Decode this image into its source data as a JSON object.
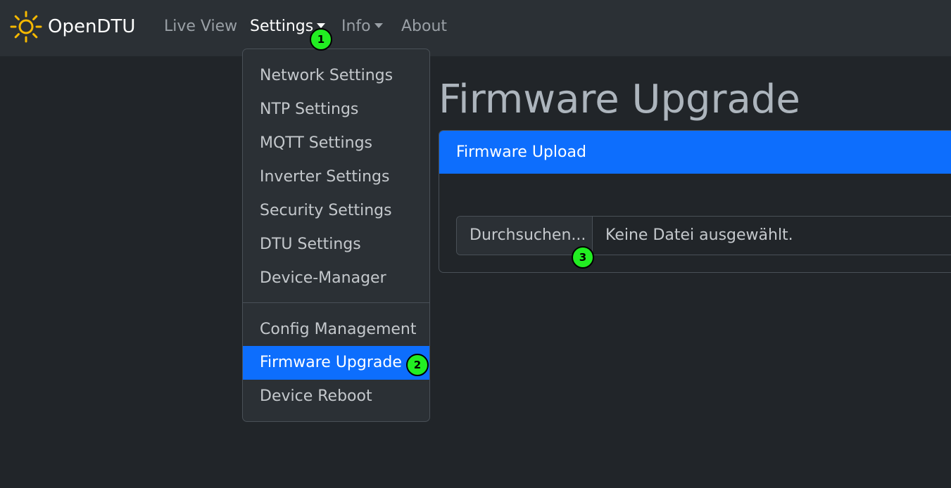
{
  "navbar": {
    "brand": {
      "icon": "sun-icon",
      "text": "OpenDTU",
      "icon_color": "#f5b800"
    },
    "links": [
      {
        "label": "Live View"
      },
      {
        "label": "Settings",
        "dropdown": true,
        "active": true
      },
      {
        "label": "Info",
        "dropdown": true
      },
      {
        "label": "About"
      }
    ]
  },
  "settings_menu": {
    "groups": [
      [
        "Network Settings",
        "NTP Settings",
        "MQTT Settings",
        "Inverter Settings",
        "Security Settings",
        "DTU Settings",
        "Device-Manager"
      ],
      [
        "Config Management",
        "Firmware Upgrade",
        "Device Reboot"
      ]
    ],
    "active_item": "Firmware Upgrade"
  },
  "page": {
    "title": "Firmware Upgrade",
    "card": {
      "header": "Firmware Upload",
      "file_input": {
        "button_label": "Durchsuchen...",
        "status_text": "Keine Datei ausgewählt."
      }
    }
  },
  "step_markers": [
    "1",
    "2",
    "3"
  ],
  "colors": {
    "accent": "#0d6efd",
    "marker": "#22ee22",
    "navbar_bg": "#2b3035",
    "page_bg": "#212529"
  }
}
